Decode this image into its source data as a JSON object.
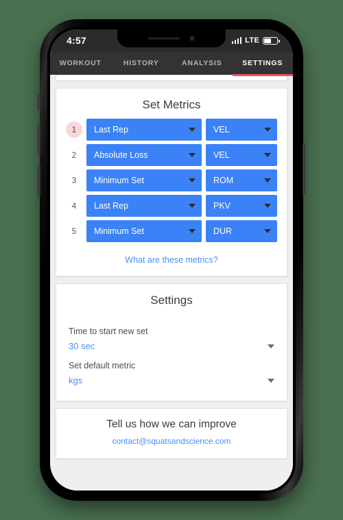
{
  "status_bar": {
    "time": "4:57",
    "carrier": "LTE",
    "signal_icon": "signal-bars-icon",
    "battery_icon": "battery-icon"
  },
  "tabs": [
    {
      "label": "WORKOUT",
      "active": false
    },
    {
      "label": "HISTORY",
      "active": false
    },
    {
      "label": "ANALYSIS",
      "active": false
    },
    {
      "label": "SETTINGS",
      "active": true
    }
  ],
  "metrics_card": {
    "title": "Set Metrics",
    "rows": [
      {
        "index": "1",
        "highlighted": true,
        "metric": "Last Rep",
        "unit": "VEL"
      },
      {
        "index": "2",
        "highlighted": false,
        "metric": "Absolute Loss",
        "unit": "VEL"
      },
      {
        "index": "3",
        "highlighted": false,
        "metric": "Minimum Set",
        "unit": "ROM"
      },
      {
        "index": "4",
        "highlighted": false,
        "metric": "Last Rep",
        "unit": "PKV"
      },
      {
        "index": "5",
        "highlighted": false,
        "metric": "Minimum Set",
        "unit": "DUR"
      }
    ],
    "help_link": "What are these metrics?"
  },
  "settings_card": {
    "title": "Settings",
    "fields": [
      {
        "label": "Time to start new set",
        "value": "30 sec"
      },
      {
        "label": "Set default metric",
        "value": "kgs"
      }
    ]
  },
  "feedback_card": {
    "title": "Tell us how we can improve",
    "email": "contact@squatsandscience.com"
  },
  "colors": {
    "page_background": "#4a7050",
    "accent_blue": "#3b82f6",
    "link_blue": "#4b8df5",
    "tab_underline": "#e8565c",
    "badge_pink": "#f9d7da",
    "tab_bar": "#333333",
    "status_bar": "#2b2b2b"
  }
}
